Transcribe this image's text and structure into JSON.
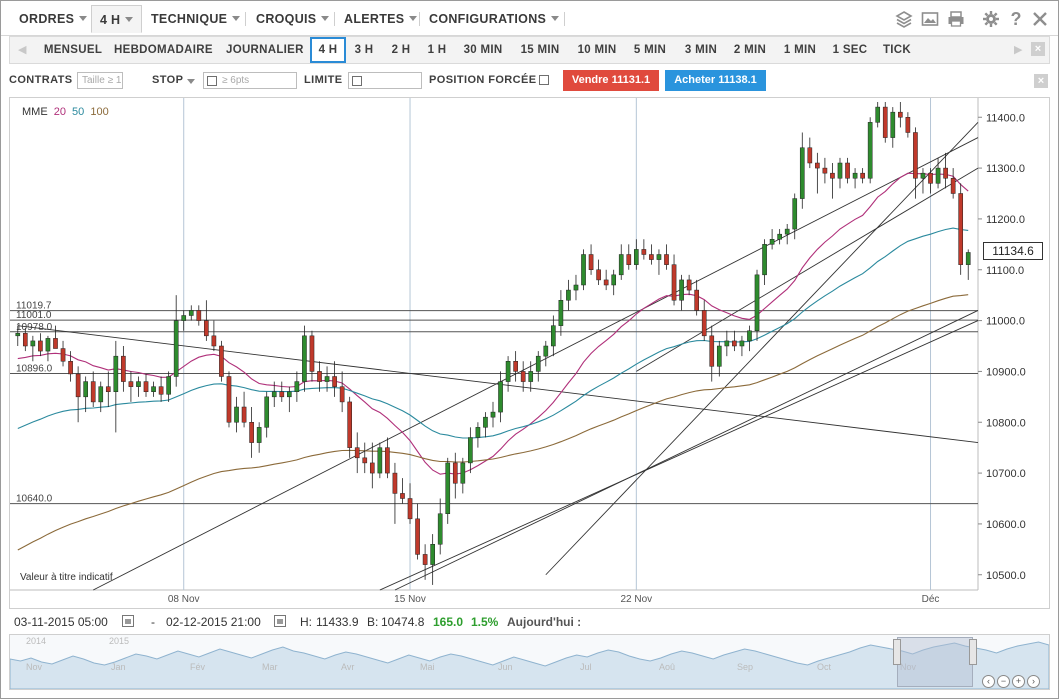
{
  "top_menu": {
    "items": [
      {
        "label": "ORDRES"
      },
      {
        "label": "4 H"
      },
      {
        "label": "TECHNIQUE"
      },
      {
        "label": "CROQUIS"
      },
      {
        "label": "ALERTES"
      },
      {
        "label": "CONFIGURATIONS"
      }
    ],
    "icons": [
      "layers-icon",
      "image-icon",
      "print-icon",
      "gear-icon",
      "help-icon",
      "close-icon"
    ]
  },
  "timeframes": {
    "items": [
      "MENSUEL",
      "HEBDOMADAIRE",
      "JOURNALIER",
      "4 H",
      "3 H",
      "2 H",
      "1 H",
      "30 MIN",
      "15 MIN",
      "10 MIN",
      "5 MIN",
      "3 MIN",
      "2 MIN",
      "1 MIN",
      "1 SEC",
      "TICK"
    ],
    "active": "4 H"
  },
  "order_bar": {
    "contracts_label": "CONTRATS",
    "contracts_placeholder": "Taille ≥ 1",
    "stop_label": "STOP",
    "stop_placeholder": "≥ 6pts",
    "limit_label": "LIMITE",
    "forced_position_label": "POSITION FORCÉE",
    "sell_label": "Vendre 11131.1",
    "buy_label": "Acheter 11138.1"
  },
  "legend": {
    "indicator": "MME",
    "periods": [
      "20",
      "50",
      "100"
    ],
    "colors": [
      "#b0307a",
      "#2b8a9e",
      "#8b6a3a"
    ]
  },
  "watermark": "Valeur à titre indicatif",
  "price_box": "11134.6",
  "range_bar": {
    "start": "03-11-2015 05:00",
    "separator": "-",
    "end": "02-12-2015 21:00",
    "high_label": "H:",
    "high": "11433.9",
    "low_label": "B:",
    "low": "10474.8",
    "change": "165.0",
    "change_pct": "1.5%",
    "today_label": "Aujourd'hui :"
  },
  "navigator": {
    "years": [
      "2014",
      "2015"
    ],
    "months": [
      "Nov",
      "Jan",
      "Fév",
      "Mar",
      "Avr",
      "Mai",
      "Jun",
      "Jul",
      "Aoû",
      "Sep",
      "Oct",
      "Nov"
    ]
  },
  "chart_data": {
    "type": "candlestick",
    "y_axis_labels": [
      "11400.0",
      "11300.0",
      "11200.0",
      "11100.0",
      "11000.0",
      "10900.0",
      "10800.0",
      "10700.0",
      "10600.0",
      "10500.0"
    ],
    "ylim": [
      10470,
      11430
    ],
    "x_axis_labels": [
      "08 Nov",
      "15 Nov",
      "22 Nov",
      "Déc"
    ],
    "horizontal_levels": [
      {
        "label": "11019.7",
        "value": 11019.7
      },
      {
        "label": "11001.0",
        "value": 11001.0
      },
      {
        "label": "10978.0",
        "value": 10978.0
      },
      {
        "label": "10896.0",
        "value": 10896.0
      },
      {
        "label": "10640.0",
        "value": 10640.0
      }
    ],
    "candle_count": 128,
    "up_color": "#2e8b2e",
    "down_color": "#c0392b",
    "candles_ohlc": [
      [
        10970,
        10990,
        10950,
        10975
      ],
      [
        10975,
        10985,
        10940,
        10950
      ],
      [
        10950,
        10970,
        10920,
        10960
      ],
      [
        10960,
        10975,
        10930,
        10940
      ],
      [
        10940,
        10970,
        10920,
        10965
      ],
      [
        10965,
        10990,
        10950,
        10945
      ],
      [
        10945,
        10960,
        10910,
        10920
      ],
      [
        10920,
        10940,
        10880,
        10895
      ],
      [
        10895,
        10910,
        10800,
        10850
      ],
      [
        10850,
        10890,
        10820,
        10880
      ],
      [
        10880,
        10900,
        10830,
        10840
      ],
      [
        10840,
        10880,
        10820,
        10870
      ],
      [
        10870,
        10900,
        10830,
        10860
      ],
      [
        10860,
        10960,
        10780,
        10930
      ],
      [
        10930,
        10950,
        10860,
        10880
      ],
      [
        10880,
        10900,
        10840,
        10870
      ],
      [
        10870,
        10890,
        10850,
        10880
      ],
      [
        10880,
        10895,
        10850,
        10860
      ],
      [
        10860,
        10880,
        10850,
        10870
      ],
      [
        10870,
        10890,
        10840,
        10855
      ],
      [
        10855,
        10900,
        10840,
        10890
      ],
      [
        10890,
        11050,
        10870,
        11000
      ],
      [
        11000,
        11020,
        10980,
        11010
      ],
      [
        11010,
        11030,
        11000,
        11020
      ],
      [
        11020,
        11030,
        10990,
        11000
      ],
      [
        11000,
        11040,
        10960,
        10970
      ],
      [
        10970,
        11000,
        10940,
        10950
      ],
      [
        10950,
        10960,
        10880,
        10890
      ],
      [
        10890,
        10900,
        10790,
        10800
      ],
      [
        10800,
        10850,
        10780,
        10830
      ],
      [
        10830,
        10860,
        10790,
        10800
      ],
      [
        10800,
        10830,
        10730,
        10760
      ],
      [
        10760,
        10800,
        10740,
        10790
      ],
      [
        10790,
        10860,
        10770,
        10850
      ],
      [
        10850,
        10880,
        10830,
        10860
      ],
      [
        10860,
        10880,
        10840,
        10850
      ],
      [
        10850,
        10870,
        10820,
        10860
      ],
      [
        10860,
        10900,
        10840,
        10880
      ],
      [
        10880,
        10990,
        10860,
        10970
      ],
      [
        10970,
        10980,
        10880,
        10900
      ],
      [
        10900,
        10920,
        10860,
        10880
      ],
      [
        10880,
        10910,
        10860,
        10890
      ],
      [
        10890,
        10920,
        10850,
        10870
      ],
      [
        10870,
        10900,
        10820,
        10840
      ],
      [
        10840,
        10850,
        10730,
        10750
      ],
      [
        10750,
        10780,
        10700,
        10730
      ],
      [
        10730,
        10760,
        10700,
        10720
      ],
      [
        10720,
        10760,
        10670,
        10700
      ],
      [
        10700,
        10760,
        10690,
        10750
      ],
      [
        10750,
        10770,
        10690,
        10700
      ],
      [
        10700,
        10720,
        10600,
        10660
      ],
      [
        10660,
        10690,
        10640,
        10650
      ],
      [
        10650,
        10680,
        10600,
        10610
      ],
      [
        10610,
        10640,
        10530,
        10540
      ],
      [
        10540,
        10560,
        10490,
        10520
      ],
      [
        10520,
        10580,
        10480,
        10560
      ],
      [
        10560,
        10650,
        10540,
        10620
      ],
      [
        10620,
        10730,
        10600,
        10720
      ],
      [
        10720,
        10740,
        10650,
        10680
      ],
      [
        10680,
        10730,
        10660,
        10720
      ],
      [
        10720,
        10790,
        10700,
        10770
      ],
      [
        10770,
        10800,
        10750,
        10790
      ],
      [
        10790,
        10820,
        10770,
        10810
      ],
      [
        10810,
        10840,
        10790,
        10820
      ],
      [
        10820,
        10900,
        10800,
        10880
      ],
      [
        10880,
        10930,
        10860,
        10920
      ],
      [
        10920,
        10940,
        10880,
        10900
      ],
      [
        10900,
        10920,
        10860,
        10880
      ],
      [
        10880,
        10920,
        10860,
        10900
      ],
      [
        10900,
        10940,
        10880,
        10930
      ],
      [
        10930,
        10960,
        10910,
        10950
      ],
      [
        10950,
        11010,
        10930,
        10990
      ],
      [
        10990,
        11060,
        10970,
        11040
      ],
      [
        11040,
        11080,
        11020,
        11060
      ],
      [
        11060,
        11090,
        11040,
        11070
      ],
      [
        11070,
        11140,
        11060,
        11130
      ],
      [
        11130,
        11150,
        11090,
        11100
      ],
      [
        11100,
        11120,
        11070,
        11080
      ],
      [
        11080,
        11100,
        11060,
        11070
      ],
      [
        11070,
        11100,
        11050,
        11090
      ],
      [
        11090,
        11150,
        11080,
        11130
      ],
      [
        11130,
        11150,
        11100,
        11110
      ],
      [
        11110,
        11160,
        11100,
        11140
      ],
      [
        11140,
        11160,
        11120,
        11130
      ],
      [
        11130,
        11150,
        11110,
        11120
      ],
      [
        11120,
        11140,
        11090,
        11130
      ],
      [
        11130,
        11150,
        11100,
        11110
      ],
      [
        11110,
        11130,
        11030,
        11040
      ],
      [
        11040,
        11090,
        11020,
        11080
      ],
      [
        11080,
        11090,
        11050,
        11060
      ],
      [
        11060,
        11080,
        11010,
        11020
      ],
      [
        11020,
        11040,
        10960,
        10970
      ],
      [
        10970,
        10990,
        10880,
        10910
      ],
      [
        10910,
        10960,
        10890,
        10950
      ],
      [
        10950,
        10980,
        10930,
        10960
      ],
      [
        10960,
        10980,
        10940,
        10950
      ],
      [
        10950,
        10970,
        10930,
        10960
      ],
      [
        10960,
        10990,
        10940,
        10980
      ],
      [
        10980,
        11100,
        10960,
        11090
      ],
      [
        11090,
        11160,
        11070,
        11150
      ],
      [
        11150,
        11180,
        11140,
        11160
      ],
      [
        11160,
        11180,
        11150,
        11170
      ],
      [
        11170,
        11190,
        11150,
        11180
      ],
      [
        11180,
        11250,
        11160,
        11240
      ],
      [
        11240,
        11370,
        11220,
        11340
      ],
      [
        11340,
        11360,
        11300,
        11310
      ],
      [
        11310,
        11330,
        11250,
        11300
      ],
      [
        11300,
        11320,
        11270,
        11290
      ],
      [
        11290,
        11310,
        11240,
        11280
      ],
      [
        11280,
        11320,
        11260,
        11310
      ],
      [
        11310,
        11320,
        11270,
        11280
      ],
      [
        11280,
        11300,
        11260,
        11290
      ],
      [
        11290,
        11300,
        11270,
        11280
      ],
      [
        11280,
        11400,
        11270,
        11390
      ],
      [
        11390,
        11430,
        11380,
        11420
      ],
      [
        11420,
        11430,
        11350,
        11360
      ],
      [
        11360,
        11420,
        11340,
        11410
      ],
      [
        11410,
        11430,
        11380,
        11400
      ],
      [
        11400,
        11410,
        11360,
        11370
      ],
      [
        11370,
        11380,
        11240,
        11280
      ],
      [
        11280,
        11300,
        11250,
        11290
      ],
      [
        11290,
        11300,
        11250,
        11270
      ],
      [
        11270,
        11320,
        11260,
        11300
      ],
      [
        11300,
        11330,
        11260,
        11280
      ],
      [
        11280,
        11300,
        11240,
        11250
      ],
      [
        11250,
        11270,
        11090,
        11110
      ],
      [
        11110,
        11140,
        11080,
        11134
      ]
    ]
  }
}
